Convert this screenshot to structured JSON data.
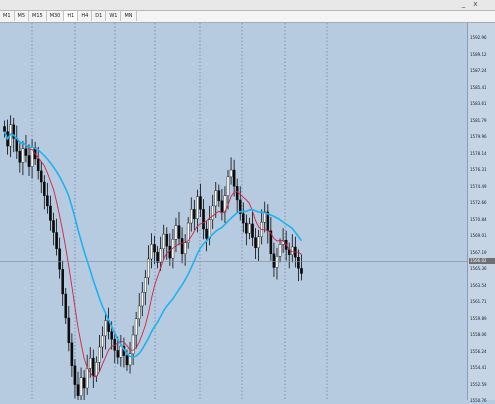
{
  "window": {
    "minimize_label": "_",
    "close_label": "x"
  },
  "timeframes": [
    {
      "label": "M1",
      "active": false
    },
    {
      "label": "M5",
      "active": false
    },
    {
      "label": "M15",
      "active": false
    },
    {
      "label": "M30",
      "active": false
    },
    {
      "label": "H1",
      "active": true
    },
    {
      "label": "H4",
      "active": false
    },
    {
      "label": "D1",
      "active": false
    },
    {
      "label": "W1",
      "active": false
    },
    {
      "label": "MN",
      "active": false
    }
  ],
  "price_axis": {
    "ticks": [
      "1592.96",
      "1589.12",
      "1587.24",
      "1585.41",
      "1583.61",
      "1581.79",
      "1579.96",
      "1578.14",
      "1576.31",
      "1574.49",
      "1572.66",
      "1570.84",
      "1569.01",
      "1567.19",
      "1565.36",
      "1563.54",
      "1561.71",
      "1559.89",
      "1558.06",
      "1556.24",
      "1554.41",
      "1552.59",
      "1550.76"
    ],
    "current_price": "1566.02"
  },
  "colors": {
    "background": "#b7cbe0",
    "candle": "#0a0a0a",
    "fast_ma": "#d2233f",
    "slow_ma": "#1fb2ee",
    "grid": "#5a6e88",
    "price_line": "#7e8da0"
  },
  "chart_data": {
    "type": "candlestick",
    "grid": "vertical-dashed",
    "ylim": [
      1549.8,
      1593.9
    ],
    "candles_close": [
      1581.2,
      1579.5,
      1582.0,
      1580.4,
      1578.9,
      1577.6,
      1579.2,
      1578.4,
      1577.1,
      1579.3,
      1578.0,
      1576.6,
      1575.3,
      1573.7,
      1572.5,
      1570.8,
      1569.4,
      1567.5,
      1565.1,
      1562.2,
      1559.4,
      1556.5,
      1553.8,
      1551.6,
      1550.3,
      1552.4,
      1551.2,
      1553.5,
      1554.7,
      1552.6,
      1554.2,
      1556.0,
      1557.3,
      1559.1,
      1557.8,
      1556.9,
      1555.6,
      1554.8,
      1556.1,
      1555.0,
      1553.9,
      1555.2,
      1557.4,
      1559.3,
      1560.8,
      1562.4,
      1564.1,
      1566.3,
      1568.0,
      1567.1,
      1565.9,
      1567.5,
      1569.2,
      1567.8,
      1566.4,
      1568.6,
      1570.2,
      1568.7,
      1566.9,
      1568.2,
      1570.5,
      1572.1,
      1571.0,
      1573.6,
      1572.1,
      1569.8,
      1568.7,
      1570.9,
      1572.5,
      1574.3,
      1573.1,
      1571.8,
      1573.7,
      1575.9,
      1576.7,
      1574.8,
      1573.2,
      1571.6,
      1570.5,
      1569.3,
      1570.4,
      1568.8,
      1567.6,
      1568.9,
      1570.6,
      1571.8,
      1569.6,
      1566.9,
      1565.3,
      1566.6,
      1568.0,
      1568.5,
      1567.4,
      1566.8,
      1567.7,
      1566.5,
      1565.2,
      1564.6
    ]
  }
}
